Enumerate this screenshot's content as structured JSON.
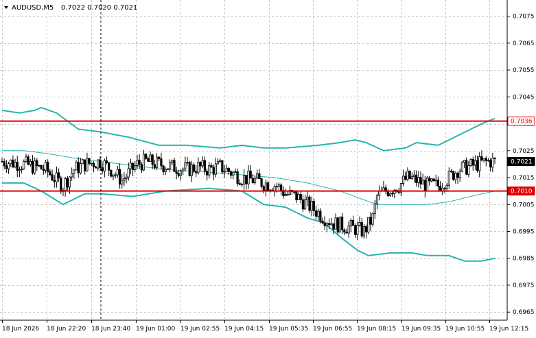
{
  "header": {
    "symbol": "AUDUSD,M5",
    "ohlc": "0.7022 0.7020 0.7021"
  },
  "colors": {
    "background": "#ffffff",
    "grid": "#c8c8c8",
    "candle": "#000000",
    "bands": "#26b5b0",
    "level_line": "#e00000",
    "price_badge": "#000000",
    "level_badge": "#e00000"
  },
  "chart_data": {
    "type": "candlestick",
    "title": "AUDUSD,M5",
    "ylim": [
      0.6962,
      0.7081
    ],
    "y_ticks": [
      "0.7075",
      "0.7065",
      "0.7055",
      "0.7045",
      "0.7035",
      "0.7025",
      "0.7015",
      "0.7005",
      "0.6995",
      "0.6985",
      "0.6975",
      "0.6965"
    ],
    "x_ticks": [
      "18 Jun 2026",
      "18 Jun 22:20",
      "18 Jun 23:40",
      "19 Jun 01:00",
      "19 Jun 02:55",
      "19 Jun 04:15",
      "19 Jun 05:35",
      "19 Jun 06:55",
      "19 Jun 08:15",
      "19 Jun 09:35",
      "19 Jun 10:55",
      "19 Jun 12:15"
    ],
    "current_price": "0.7021",
    "levels": [
      "0.7036",
      "0.7010"
    ],
    "close_path": [
      [
        0,
        0.7021
      ],
      [
        10,
        0.702
      ],
      [
        15,
        0.7019
      ],
      [
        20,
        0.7018
      ],
      [
        25,
        0.7014
      ],
      [
        28,
        0.7012
      ],
      [
        33,
        0.7018
      ],
      [
        38,
        0.702
      ],
      [
        45,
        0.7021
      ],
      [
        50,
        0.7018
      ],
      [
        55,
        0.7014
      ],
      [
        62,
        0.702
      ],
      [
        66,
        0.7021
      ],
      [
        72,
        0.702
      ],
      [
        78,
        0.7019
      ],
      [
        85,
        0.7018
      ],
      [
        90,
        0.7019
      ],
      [
        95,
        0.7018
      ],
      [
        100,
        0.7019
      ],
      [
        105,
        0.7017
      ],
      [
        110,
        0.7015
      ],
      [
        116,
        0.7014
      ],
      [
        120,
        0.7013
      ],
      [
        126,
        0.7012
      ],
      [
        130,
        0.7009
      ],
      [
        135,
        0.7008
      ],
      [
        140,
        0.7005
      ],
      [
        145,
        0.7002
      ],
      [
        148,
        0.7
      ],
      [
        152,
        0.6998
      ],
      [
        157,
        0.6997
      ],
      [
        162,
        0.6996
      ],
      [
        166,
        0.6995
      ],
      [
        170,
        0.7
      ],
      [
        172,
        0.7008
      ],
      [
        176,
        0.701
      ],
      [
        182,
        0.7012
      ],
      [
        186,
        0.7015
      ],
      [
        190,
        0.7014
      ],
      [
        195,
        0.7012
      ],
      [
        200,
        0.7012
      ],
      [
        205,
        0.7015
      ],
      [
        209,
        0.7018
      ],
      [
        214,
        0.7019
      ],
      [
        218,
        0.702
      ],
      [
        223,
        0.7021
      ],
      [
        226,
        0.7021
      ]
    ],
    "bands": {
      "upper": [
        [
          0,
          0.704
        ],
        [
          8,
          0.7039
        ],
        [
          15,
          0.704
        ],
        [
          18,
          0.7041
        ],
        [
          25,
          0.7039
        ],
        [
          35,
          0.7033
        ],
        [
          45,
          0.7032
        ],
        [
          58,
          0.703
        ],
        [
          72,
          0.7027
        ],
        [
          85,
          0.7027
        ],
        [
          100,
          0.7026
        ],
        [
          110,
          0.7027
        ],
        [
          120,
          0.7026
        ],
        [
          130,
          0.7026
        ],
        [
          145,
          0.7027
        ],
        [
          155,
          0.7028
        ],
        [
          162,
          0.7029
        ],
        [
          167,
          0.7028
        ],
        [
          175,
          0.7025
        ],
        [
          185,
          0.7026
        ],
        [
          190,
          0.7028
        ],
        [
          200,
          0.7027
        ],
        [
          210,
          0.7031
        ],
        [
          220,
          0.7035
        ],
        [
          226,
          0.7037
        ]
      ],
      "middle": [
        [
          0,
          0.7025
        ],
        [
          10,
          0.7025
        ],
        [
          20,
          0.7024
        ],
        [
          35,
          0.7022
        ],
        [
          55,
          0.702
        ],
        [
          75,
          0.7018
        ],
        [
          95,
          0.7017
        ],
        [
          110,
          0.7016
        ],
        [
          125,
          0.7015
        ],
        [
          140,
          0.7013
        ],
        [
          155,
          0.701
        ],
        [
          165,
          0.7007
        ],
        [
          172,
          0.7005
        ],
        [
          182,
          0.7005
        ],
        [
          195,
          0.7005
        ],
        [
          205,
          0.7006
        ],
        [
          215,
          0.7008
        ],
        [
          226,
          0.701
        ]
      ],
      "lower": [
        [
          0,
          0.7013
        ],
        [
          10,
          0.7013
        ],
        [
          18,
          0.701
        ],
        [
          28,
          0.7005
        ],
        [
          38,
          0.7009
        ],
        [
          45,
          0.7009
        ],
        [
          60,
          0.7008
        ],
        [
          75,
          0.701
        ],
        [
          95,
          0.7011
        ],
        [
          110,
          0.701
        ],
        [
          120,
          0.7005
        ],
        [
          130,
          0.7004
        ],
        [
          140,
          0.7
        ],
        [
          148,
          0.6998
        ],
        [
          155,
          0.6993
        ],
        [
          163,
          0.6988
        ],
        [
          168,
          0.6986
        ],
        [
          178,
          0.6987
        ],
        [
          188,
          0.6987
        ],
        [
          195,
          0.6986
        ],
        [
          205,
          0.6986
        ],
        [
          212,
          0.6984
        ],
        [
          220,
          0.6984
        ],
        [
          226,
          0.6985
        ]
      ]
    }
  }
}
